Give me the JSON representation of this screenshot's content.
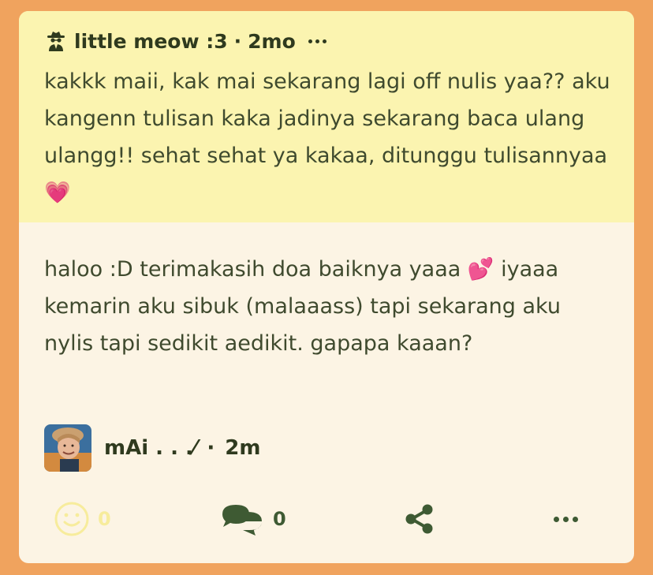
{
  "question": {
    "author_emoji": "🕵",
    "author_name": "little meow :3",
    "separator": "·",
    "time": "2mo",
    "more_icon": "more-dots-icon",
    "text": "kakkk maii, kak mai sekarang lagi off nulis yaa?? aku kangenn tulisan kaka jadinya sekarang baca ulang ulangg!! sehat sehat ya kakaa, ditunggu tulisannyaa💗"
  },
  "answer": {
    "text": "haloo :D terimakasih doa baiknya yaaa 💕 iyaaa kemarin aku sibuk (malaaass) tapi sekarang aku nylis tapi sedikit aedikit. gapapa kaaan?",
    "author_name": "mAi . . .⁄",
    "separator": "·",
    "time": "2m"
  },
  "actions": {
    "react_icon": "smiley-icon",
    "react_count": "0",
    "comment_icon": "chat-bubbles-icon",
    "comment_count": "0",
    "share_icon": "share-icon",
    "more_icon": "more-dots-icon"
  },
  "colors": {
    "background": "#f0a35e",
    "card": "#fcf4e4",
    "question_bg": "#fbf4b0",
    "text": "#3f4a2e",
    "icon_dark": "#3e5a33",
    "react_inactive": "#f7ec9c"
  }
}
